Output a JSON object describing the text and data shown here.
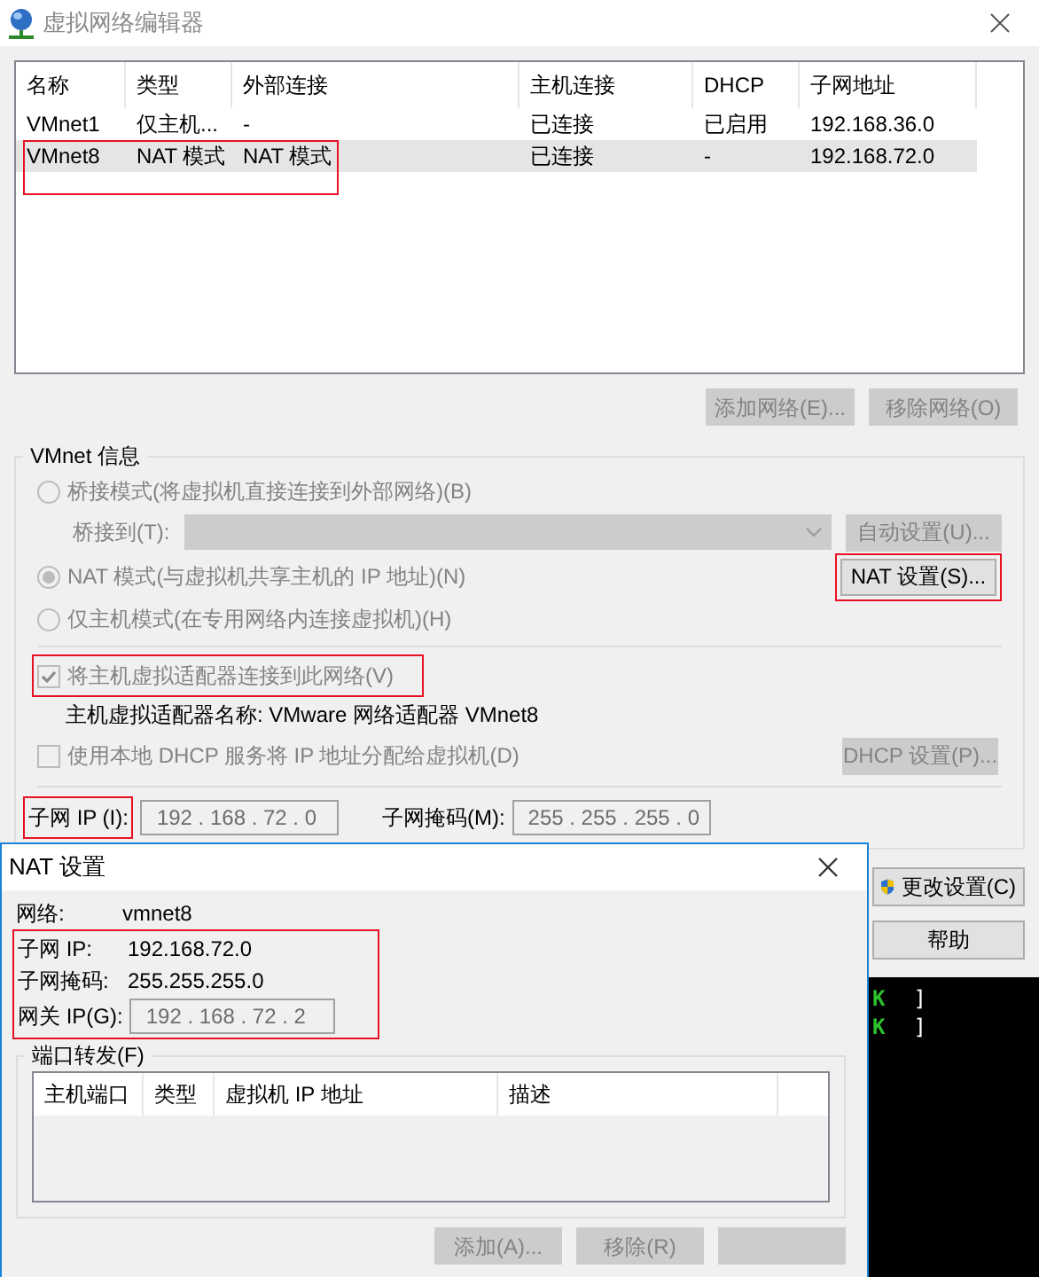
{
  "window": {
    "title": "虚拟网络编辑器"
  },
  "networks": {
    "columns": [
      "名称",
      "类型",
      "外部连接",
      "主机连接",
      "DHCP",
      "子网地址"
    ],
    "rows": [
      {
        "cells": [
          "VMnet1",
          "仅主机...",
          "-",
          "已连接",
          "已启用",
          "192.168.36.0"
        ],
        "selected": false,
        "highlighted": false
      },
      {
        "cells": [
          "VMnet8",
          "NAT 模式",
          "NAT 模式",
          "已连接",
          "-",
          "192.168.72.0"
        ],
        "selected": true,
        "highlighted": true
      }
    ]
  },
  "network_buttons": [
    {
      "label": "添加网络(E)...",
      "disabled": true
    },
    {
      "label": "移除网络(O)",
      "disabled": true
    }
  ],
  "vmnet_info": {
    "title": "VMnet 信息",
    "modes": [
      {
        "label": "桥接模式(将虚拟机直接连接到外部网络)(B)",
        "selected": false,
        "disabled": true
      },
      {
        "label": "NAT 模式(与虚拟机共享主机的 IP 地址)(N)",
        "selected": true,
        "disabled": true
      },
      {
        "label": "仅主机模式(在专用网络内连接虚拟机)(H)",
        "selected": false,
        "disabled": true
      }
    ],
    "bridge_label": "桥接到(T):",
    "auto_button": {
      "label": "自动设置(U)...",
      "disabled": true
    },
    "nat_button": {
      "label": "NAT 设置(S)...",
      "highlighted": true
    },
    "connect_adapter": {
      "label": "将主机虚拟适配器连接到此网络(V)",
      "checked": true,
      "disabled": true,
      "highlighted": true
    },
    "adapter_name": "主机虚拟适配器名称: VMware 网络适配器 VMnet8",
    "dhcp": {
      "label": "使用本地 DHCP 服务将 IP 地址分配给虚拟机(D)",
      "checked": false,
      "disabled": true
    },
    "dhcp_button": {
      "label": "DHCP 设置(P)...",
      "disabled": true
    },
    "subnet_ip": {
      "label": "子网 IP (I):",
      "value": "192 . 168 . 72 . 0",
      "highlighted": true
    },
    "subnet_mask": {
      "label": "子网掩码(M):",
      "value": "255 . 255 . 255 . 0"
    }
  },
  "side_buttons": [
    {
      "label": "更改设置(C)",
      "kind": "shield"
    },
    {
      "label": "帮助",
      "kind": "plain"
    }
  ],
  "terminal": {
    "lines": [
      {
        "status": "K",
        "bracket": "]"
      },
      {
        "status": "K",
        "bracket": "]"
      }
    ]
  },
  "nat_dialog": {
    "title": "NAT 设置",
    "network_label": "网络:",
    "network": "vmnet8",
    "subnet_ip_label": "子网 IP:",
    "subnet_ip": "192.168.72.0",
    "subnet_mask_label": "子网掩码:",
    "subnet_mask": "255.255.255.0",
    "gateway_label": "网关 IP(G):",
    "gateway": "192 . 168 . 72 . 2",
    "highlighted": true,
    "port_forwarding": {
      "title": "端口转发(F)",
      "columns": [
        "主机端口",
        "类型",
        "虚拟机 IP 地址",
        "描述"
      ]
    },
    "buttons": [
      {
        "label": "添加(A)...",
        "disabled": true
      },
      {
        "label": "移除(R)",
        "disabled": true
      }
    ]
  }
}
